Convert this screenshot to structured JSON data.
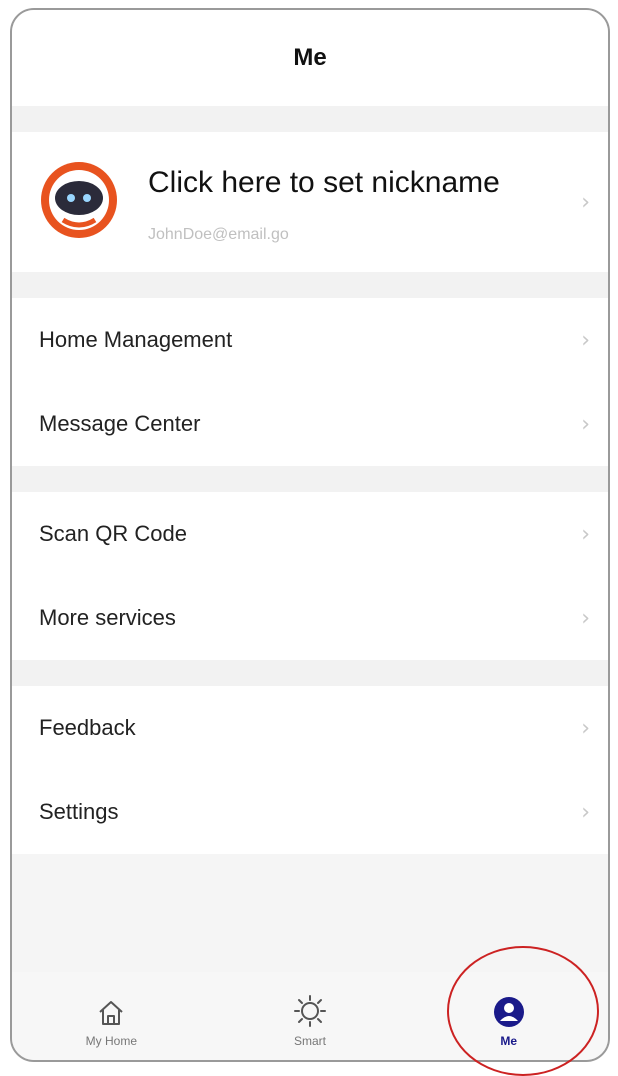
{
  "header": {
    "title": "Me"
  },
  "profile": {
    "nickname": "Click here to set nickname",
    "email": "JohnDoe@email.go",
    "avatar_icon": "robot-avatar-icon",
    "avatar_color": "#e8531f"
  },
  "groups": [
    {
      "items": [
        {
          "label": "Home Management"
        },
        {
          "label": "Message Center"
        }
      ]
    },
    {
      "items": [
        {
          "label": "Scan QR Code"
        },
        {
          "label": "More services"
        }
      ]
    },
    {
      "items": [
        {
          "label": "Feedback"
        },
        {
          "label": "Settings"
        }
      ]
    }
  ],
  "chevron": "›",
  "tabbar": {
    "tabs": [
      {
        "label": "My Home",
        "icon": "house-icon",
        "active": false
      },
      {
        "label": "Smart",
        "icon": "sun-icon",
        "active": false
      },
      {
        "label": "Me",
        "icon": "user-icon",
        "active": true
      }
    ],
    "active_color": "#1a1a8a"
  },
  "annotation": {
    "highlight_color": "#cc2222",
    "target": "Me"
  }
}
